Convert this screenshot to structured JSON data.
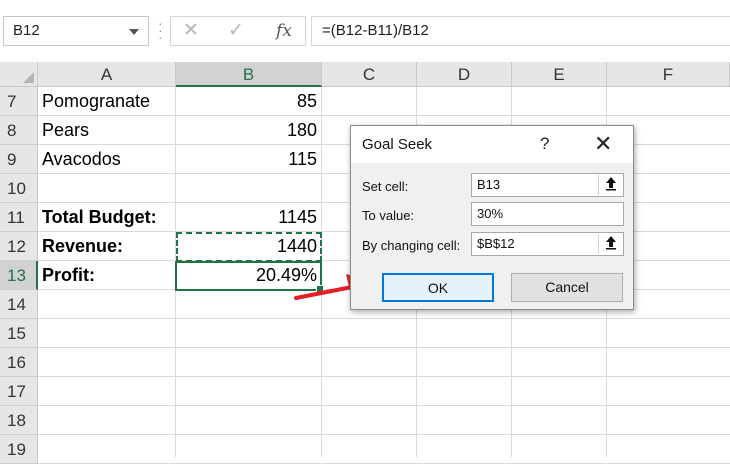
{
  "formula_bar": {
    "name_box": "B12",
    "cancel_icon": "✕",
    "enter_icon": "✓",
    "fx_label": "fx",
    "formula": "=(B12-B11)/B12"
  },
  "columns": [
    "A",
    "B",
    "C",
    "D",
    "E",
    "F"
  ],
  "selected_column": "B",
  "rows": [
    {
      "num": "7",
      "a": "Pomogranate",
      "b": "85",
      "bold": false
    },
    {
      "num": "8",
      "a": "Pears",
      "b": "180",
      "bold": false
    },
    {
      "num": "9",
      "a": "Avacodos",
      "b": "115",
      "bold": false
    },
    {
      "num": "10",
      "a": "",
      "b": "",
      "bold": false
    },
    {
      "num": "11",
      "a": "Total Budget:",
      "b": "1145",
      "bold": true
    },
    {
      "num": "12",
      "a": "Revenue:",
      "b": "1440",
      "bold": true
    },
    {
      "num": "13",
      "a": "Profit:",
      "b": "20.49%",
      "bold": true
    },
    {
      "num": "14",
      "a": "",
      "b": "",
      "bold": false
    },
    {
      "num": "15",
      "a": "",
      "b": "",
      "bold": false
    },
    {
      "num": "16",
      "a": "",
      "b": "",
      "bold": false
    },
    {
      "num": "17",
      "a": "",
      "b": "",
      "bold": false
    },
    {
      "num": "18",
      "a": "",
      "b": "",
      "bold": false
    },
    {
      "num": "19",
      "a": "",
      "b": "",
      "bold": false
    }
  ],
  "selected_row": "13",
  "dialog": {
    "title": "Goal Seek",
    "help": "?",
    "close": "✕",
    "set_cell_label": "Set cell:",
    "set_cell_value": "B13",
    "to_value_label": "To value:",
    "to_value_value": "30%",
    "changing_cell_label": "By changing cell:",
    "changing_cell_value": "$B$12",
    "ok_label": "OK",
    "cancel_label": "Cancel"
  },
  "colors": {
    "excel_green": "#217346",
    "arrow_red": "#e81e25",
    "ok_border": "#0078d7"
  }
}
